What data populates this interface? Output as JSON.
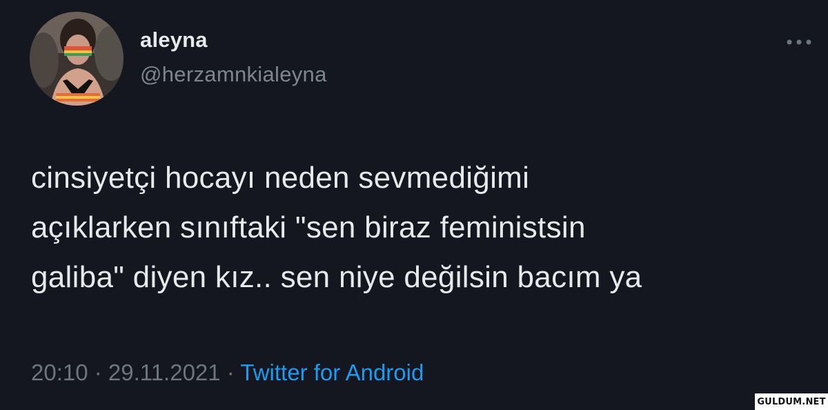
{
  "tweet": {
    "author": {
      "display_name": "aleyna",
      "handle": "@herzamnkialeyna",
      "avatar_icon": "profile-photo"
    },
    "more_icon": "more-horizontal-icon",
    "text_lines": [
      "cinsiyetçi hocayı neden sevmediğimi",
      "açıklarken sınıftaki \"sen biraz feministsin",
      "galiba\" diyen kız.. sen niye değilsin bacım ya"
    ],
    "meta": {
      "time": "20:10",
      "separator": " · ",
      "date": "29.11.2021",
      "source": "Twitter for Android"
    }
  },
  "watermark": "GULDUM.NET",
  "colors": {
    "background": "#14171f",
    "text": "#e7e9ea",
    "secondary": "#7e858c",
    "link": "#1d9bf0"
  }
}
